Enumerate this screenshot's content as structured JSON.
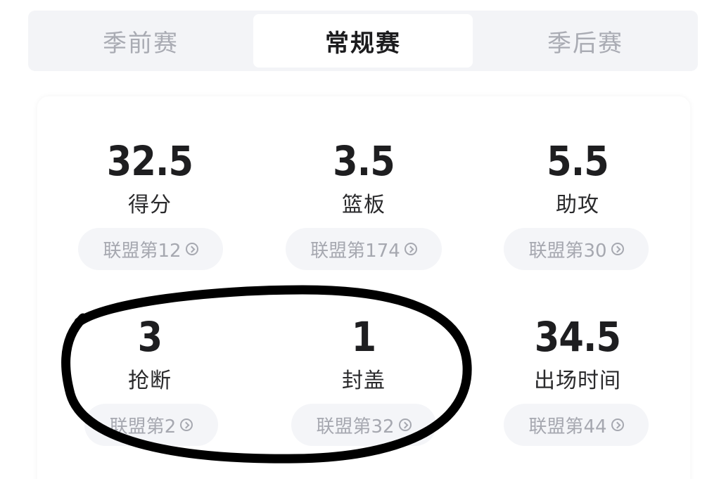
{
  "tabs": [
    {
      "label": "季前赛",
      "active": false
    },
    {
      "label": "常规赛",
      "active": true
    },
    {
      "label": "季后赛",
      "active": false
    }
  ],
  "stats": [
    {
      "value": "32.5",
      "label": "得分",
      "rank": "联盟第12"
    },
    {
      "value": "3.5",
      "label": "篮板",
      "rank": "联盟第174"
    },
    {
      "value": "5.5",
      "label": "助攻",
      "rank": "联盟第30"
    },
    {
      "value": "3",
      "label": "抢断",
      "rank": "联盟第2"
    },
    {
      "value": "1",
      "label": "封盖",
      "rank": "联盟第32"
    },
    {
      "value": "34.5",
      "label": "出场时间",
      "rank": "联盟第44"
    }
  ],
  "icons": {
    "rank_chevron": "chevron-right-circle-icon"
  },
  "colors": {
    "tab_bg": "#f3f4f7",
    "tab_active_text": "#1c1c1e",
    "tab_inactive_text": "#a9abb3",
    "rank_pill_bg": "#f4f5f8",
    "annotation": "#000000"
  }
}
